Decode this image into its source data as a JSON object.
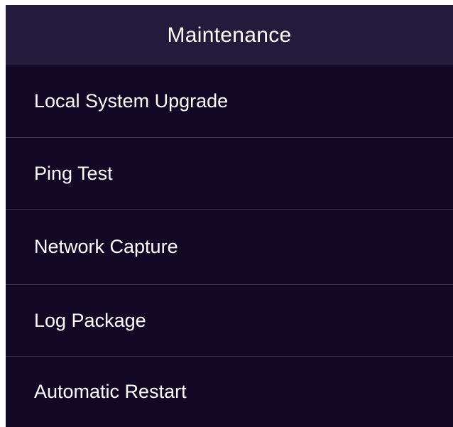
{
  "header": {
    "title": "Maintenance"
  },
  "menu": {
    "items": [
      {
        "label": "Local System Upgrade"
      },
      {
        "label": "Ping Test"
      },
      {
        "label": "Network Capture"
      },
      {
        "label": "Log Package"
      },
      {
        "label": "Automatic Restart"
      }
    ]
  },
  "colors": {
    "background": "#120826",
    "header_background": "#241a3b",
    "text": "#ffffff",
    "divider": "#3a3248"
  }
}
